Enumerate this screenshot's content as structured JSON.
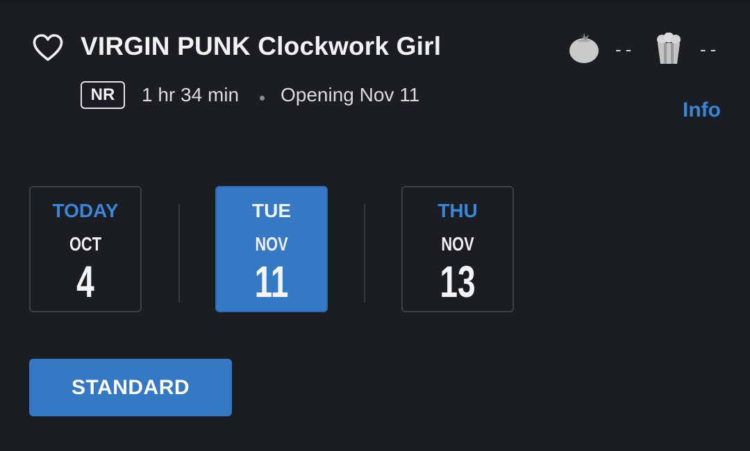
{
  "movie": {
    "title": "VIRGIN PUNK Clockwork Girl",
    "rating": "NR",
    "runtime": "1 hr 34 min",
    "opening": "Opening Nov 11"
  },
  "scores": {
    "tomatometer": "--",
    "audience": "--",
    "tomatometer_icon": "tomato-icon",
    "audience_icon": "popcorn-icon"
  },
  "info_link": "Info",
  "dates": [
    {
      "dow": "TODAY",
      "month": "OCT",
      "day": "4",
      "selected": false
    },
    {
      "dow": "TUE",
      "month": "NOV",
      "day": "11",
      "selected": true
    },
    {
      "dow": "THU",
      "month": "NOV",
      "day": "13",
      "selected": false
    }
  ],
  "format_button": "STANDARD",
  "colors": {
    "background": "#1a1d21",
    "accent": "#3578c4",
    "link": "#3a86d8"
  }
}
